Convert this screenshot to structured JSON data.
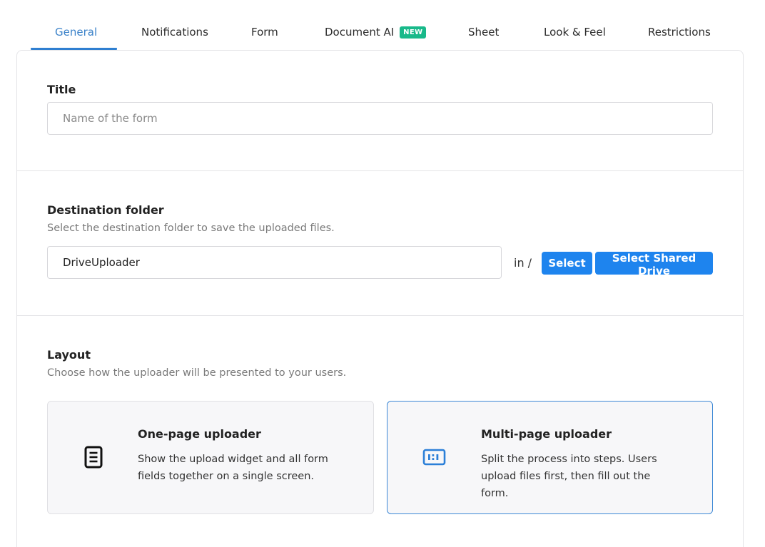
{
  "tabs": [
    {
      "label": "General",
      "active": true
    },
    {
      "label": "Notifications"
    },
    {
      "label": "Form"
    },
    {
      "label": "Document AI",
      "badge": "NEW"
    },
    {
      "label": "Sheet"
    },
    {
      "label": "Look & Feel"
    },
    {
      "label": "Restrictions"
    }
  ],
  "colors": {
    "accent": "#1e84ee",
    "badge": "#18b98a",
    "selected_border": "#3c88d6"
  },
  "title_section": {
    "label": "Title",
    "placeholder": "Name of the form",
    "value": ""
  },
  "destination": {
    "label": "Destination folder",
    "help": "Select the destination folder to save the uploaded files.",
    "folder_value": "DriveUploader",
    "path_text": "in /",
    "select_label": "Select",
    "shared_drive_label": "Select Shared Drive"
  },
  "layout": {
    "label": "Layout",
    "help": "Choose how the uploader will be presented to your users.",
    "options": [
      {
        "title": "One-page uploader",
        "description": "Show the upload widget and all form fields together on a single screen.",
        "icon": "document-icon",
        "selected": false
      },
      {
        "title": "Multi-page uploader",
        "description": "Split the process into steps. Users upload files first, then fill out the form.",
        "icon": "steps-icon",
        "selected": true
      }
    ]
  }
}
